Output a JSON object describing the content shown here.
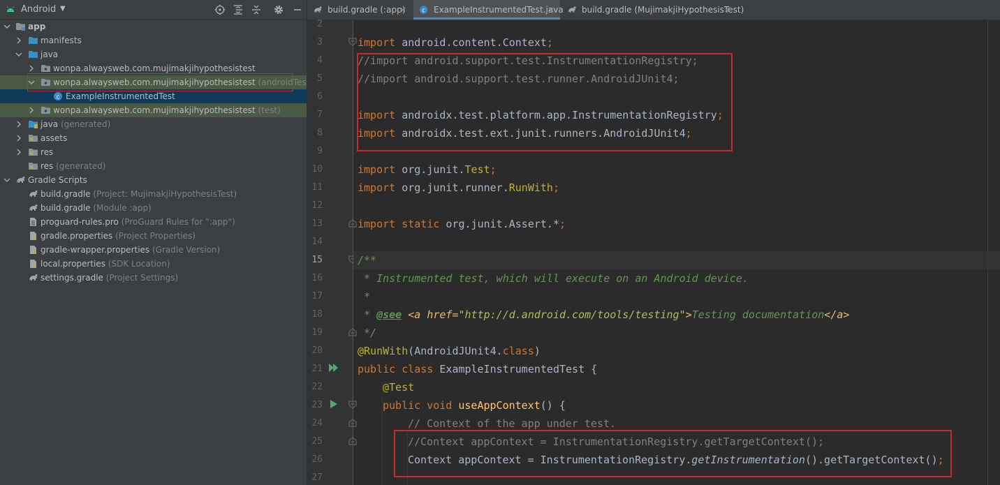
{
  "project_panel": {
    "view_name": "Android",
    "toolbar_icons": [
      "locate-icon",
      "expand-all-icon",
      "collapse-all-icon",
      "gear-icon",
      "minimize-icon"
    ],
    "tree": [
      {
        "label": "app",
        "sub": ""
      },
      {
        "label": "manifests",
        "sub": ""
      },
      {
        "label": "java",
        "sub": ""
      },
      {
        "label": "wonpa.alwaysweb.com.mujimakjihypothesistest",
        "sub": ""
      },
      {
        "label": "wonpa.alwaysweb.com.mujimakjihypothesistest",
        "sub": " (androidTest)"
      },
      {
        "label": "ExampleInstrumentedTest",
        "sub": ""
      },
      {
        "label": "wonpa.alwaysweb.com.mujimakjihypothesistest",
        "sub": " (test)"
      },
      {
        "label": "java",
        "sub": " (generated)"
      },
      {
        "label": "assets",
        "sub": ""
      },
      {
        "label": "res",
        "sub": ""
      },
      {
        "label": "res",
        "sub": " (generated)"
      },
      {
        "label": "Gradle Scripts",
        "sub": ""
      },
      {
        "label": "build.gradle",
        "sub": " (Project: MujimakjiHypothesisTest)"
      },
      {
        "label": "build.gradle",
        "sub": " (Module :app)"
      },
      {
        "label": "proguard-rules.pro",
        "sub": " (ProGuard Rules for \":app\")"
      },
      {
        "label": "gradle.properties",
        "sub": " (Project Properties)"
      },
      {
        "label": "gradle-wrapper.properties",
        "sub": " (Gradle Version)"
      },
      {
        "label": "local.properties",
        "sub": " (SDK Location)"
      },
      {
        "label": "settings.gradle",
        "sub": " (Project Settings)"
      }
    ]
  },
  "editor": {
    "tabs": [
      {
        "label": "build.gradle (:app)"
      },
      {
        "label": "ExampleInstrumentedTest.java"
      },
      {
        "label": "build.gradle (MujimakjiHypothesisTest)"
      }
    ],
    "close_glyph": "×",
    "line_numbers": [
      "2",
      "3",
      "4",
      "5",
      "6",
      "7",
      "8",
      "9",
      "10",
      "11",
      "12",
      "13",
      "14",
      "15",
      "16",
      "17",
      "18",
      "19",
      "20",
      "21",
      "22",
      "23",
      "24",
      "25",
      "26",
      "27"
    ],
    "code": {
      "l3_kw": "import",
      "l3_rest": " android.content.Context",
      "l3_sc": ";",
      "l4": "//import android.support.test.InstrumentationRegistry;",
      "l5": "//import android.support.test.runner.AndroidJUnit4;",
      "l7_kw": "import",
      "l7_rest": " androidx.test.platform.app.InstrumentationRegistry",
      "l7_sc": ";",
      "l8_kw": "import",
      "l8_rest": " androidx.test.ext.junit.runners.AndroidJUnit4",
      "l8_sc": ";",
      "l10_kw": "import",
      "l10_rest": " org.junit.",
      "l10_ann": "Test",
      "l10_sc": ";",
      "l11_kw": "import",
      "l11_rest": " org.junit.runner.",
      "l11_ann": "RunWith",
      "l11_sc": ";",
      "l13_kw": "import static",
      "l13_rest": " org.junit.Assert.*",
      "l13_sc": ";",
      "l15": "/**",
      "l16": " * Instrumented test, which will execute on an Android device.",
      "l17": " *",
      "l18_pre": " * ",
      "l18_tag": "@see",
      "l18_sp": " ",
      "l18_html1": "<a href=",
      "l18_str": "\"http://d.android.com/tools/testing\"",
      "l18_html2": ">",
      "l18_txt": "Testing documentation",
      "l18_html3": "</a>",
      "l19": " */",
      "l20_ann": "@RunWith",
      "l20_a": "(AndroidJUnit4.",
      "l20_kw": "class",
      "l20_b": ")",
      "l21_kw": "public class",
      "l21_rest": " ExampleInstrumentedTest {",
      "l22_ann": "@Test",
      "l23_kw": "public void",
      "l23_sp": " ",
      "l23_fn": "useAppContext",
      "l23_rest": "() {",
      "l24": "// Context of the app under test.",
      "l25": "//Context appContext = InstrumentationRegistry.getTargetContext();",
      "l26_a": "Context appContext = InstrumentationRegistry.",
      "l26_it": "getInstrumentation",
      "l26_b": "().getTargetContext()",
      "l26_sc": ";"
    }
  }
}
